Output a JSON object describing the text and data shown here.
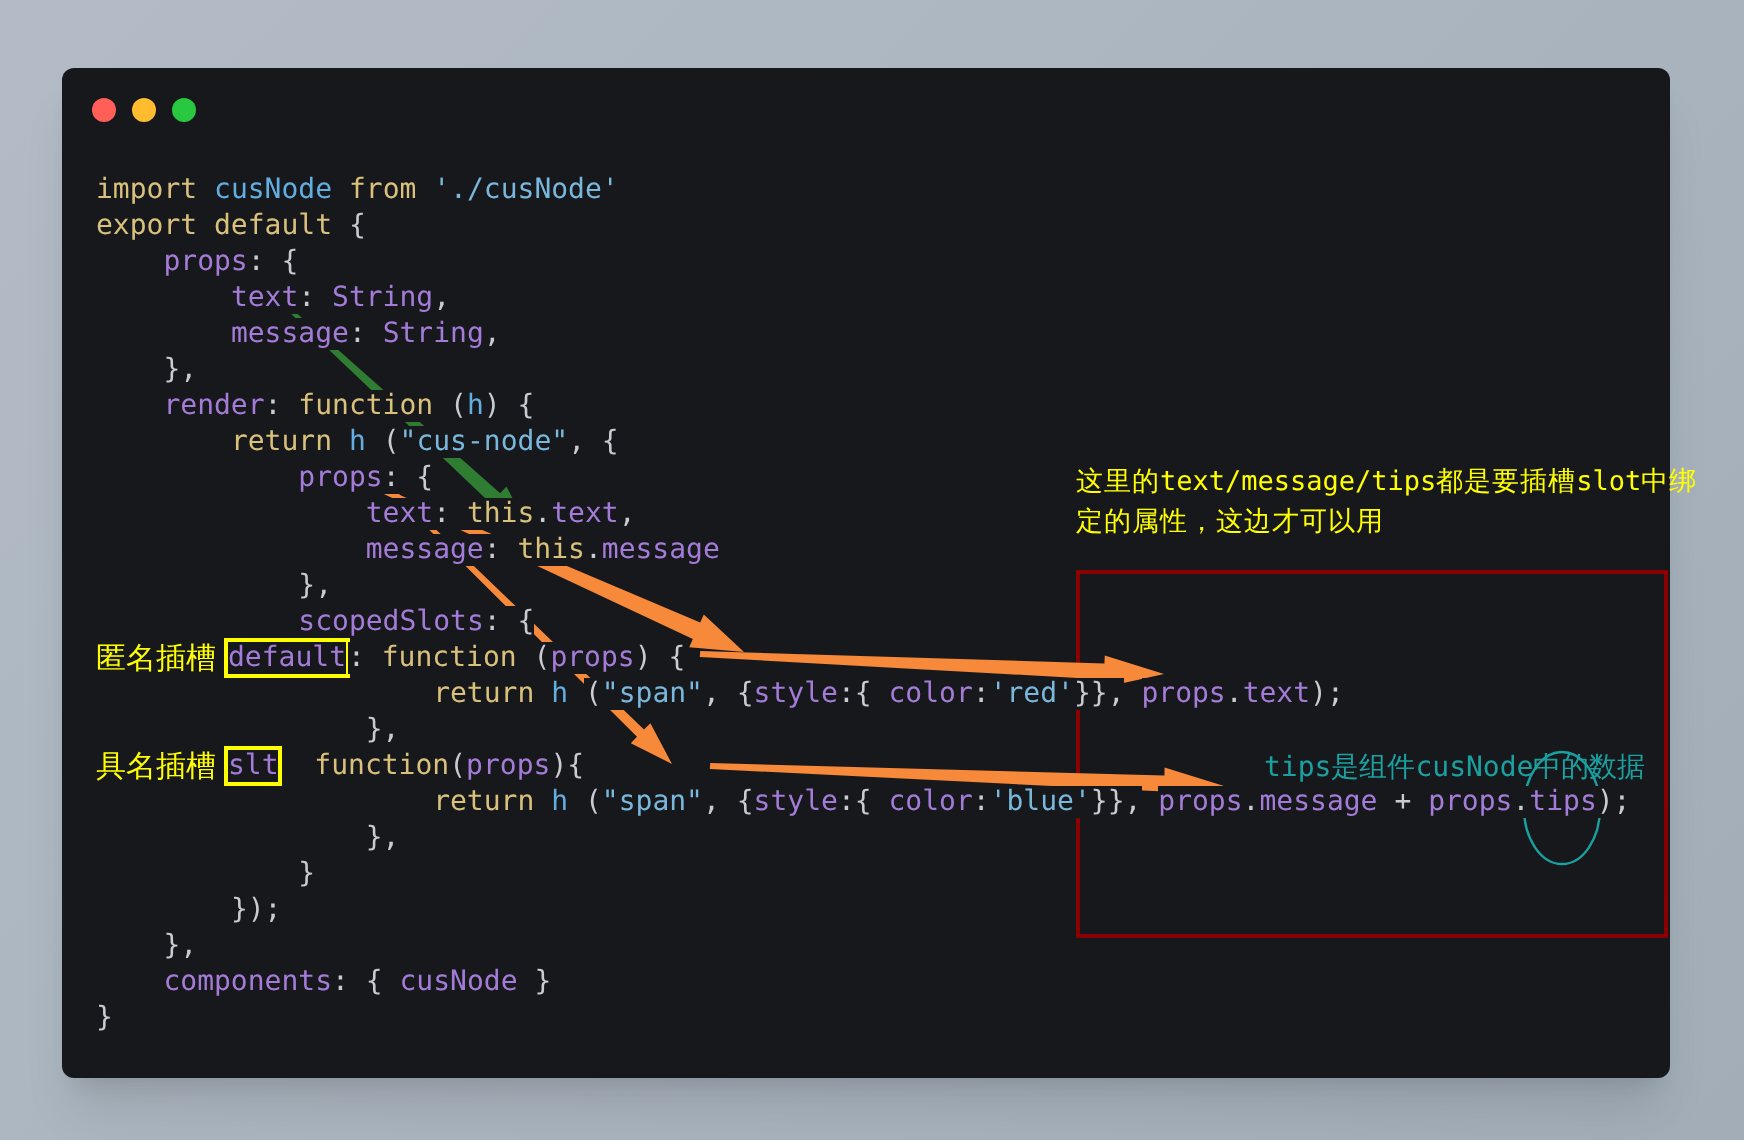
{
  "window": {
    "code_lines": [
      {
        "tokens": [
          {
            "kind": "kw",
            "text": "import"
          },
          {
            "kind": "ident",
            "text": " cusNode"
          },
          {
            "kind": "kw",
            "text": " from"
          },
          {
            "kind": "str",
            "text": " './cusNode'"
          }
        ]
      },
      {
        "tokens": [
          {
            "kind": "kw",
            "text": "export default"
          },
          {
            "kind": "punc",
            "text": " {"
          }
        ]
      },
      {
        "tokens": [
          {
            "kind": "prop",
            "text": "    props"
          },
          {
            "kind": "punc",
            "text": ": {"
          }
        ]
      },
      {
        "tokens": [
          {
            "kind": "prop",
            "text": "        text"
          },
          {
            "kind": "punc",
            "text": ": "
          },
          {
            "kind": "prop",
            "text": "String"
          },
          {
            "kind": "punc",
            "text": ","
          }
        ]
      },
      {
        "tokens": [
          {
            "kind": "prop",
            "text": "        message"
          },
          {
            "kind": "punc",
            "text": ": "
          },
          {
            "kind": "prop",
            "text": "String"
          },
          {
            "kind": "punc",
            "text": ","
          }
        ]
      },
      {
        "tokens": [
          {
            "kind": "punc",
            "text": "    },"
          }
        ]
      },
      {
        "tokens": [
          {
            "kind": "prop",
            "text": "    render"
          },
          {
            "kind": "punc",
            "text": ": "
          },
          {
            "kind": "kw",
            "text": "function"
          },
          {
            "kind": "punc",
            "text": " ("
          },
          {
            "kind": "ident",
            "text": "h"
          },
          {
            "kind": "punc",
            "text": ") {"
          }
        ]
      },
      {
        "tokens": [
          {
            "kind": "kw",
            "text": "        return"
          },
          {
            "kind": "ident",
            "text": " h"
          },
          {
            "kind": "punc",
            "text": " ("
          },
          {
            "kind": "str",
            "text": "\"cus-node\""
          },
          {
            "kind": "punc",
            "text": ", {"
          }
        ]
      },
      {
        "tokens": [
          {
            "kind": "prop",
            "text": "            props"
          },
          {
            "kind": "punc",
            "text": ": {"
          }
        ]
      },
      {
        "tokens": [
          {
            "kind": "prop",
            "text": "                text"
          },
          {
            "kind": "punc",
            "text": ": "
          },
          {
            "kind": "kw",
            "text": "this"
          },
          {
            "kind": "punc",
            "text": "."
          },
          {
            "kind": "prop",
            "text": "text"
          },
          {
            "kind": "punc",
            "text": ","
          }
        ]
      },
      {
        "tokens": [
          {
            "kind": "prop",
            "text": "                message"
          },
          {
            "kind": "punc",
            "text": ": "
          },
          {
            "kind": "kw",
            "text": "this"
          },
          {
            "kind": "punc",
            "text": "."
          },
          {
            "kind": "prop",
            "text": "message"
          }
        ]
      },
      {
        "tokens": [
          {
            "kind": "punc",
            "text": "            },"
          }
        ]
      },
      {
        "tokens": [
          {
            "kind": "prop",
            "text": "            scopedSlots"
          },
          {
            "kind": "punc",
            "text": ": {"
          }
        ]
      },
      {
        "tokens": [
          {
            "kind": "note",
            "text": "匿名插槽"
          },
          {
            "kind": "boxed",
            "text": "default"
          },
          {
            "kind": "punc",
            "text": ": "
          },
          {
            "kind": "kw",
            "text": "function"
          },
          {
            "kind": "punc",
            "text": " ("
          },
          {
            "kind": "prop",
            "text": "props"
          },
          {
            "kind": "punc",
            "text": ") {"
          }
        ]
      },
      {
        "tokens": [
          {
            "kind": "kw",
            "text": "                    return"
          },
          {
            "kind": "ident",
            "text": " h"
          },
          {
            "kind": "punc",
            "text": " ("
          },
          {
            "kind": "str",
            "text": "\"span\""
          },
          {
            "kind": "punc",
            "text": ", {"
          },
          {
            "kind": "prop",
            "text": "style"
          },
          {
            "kind": "punc",
            "text": ":{"
          },
          {
            "kind": "prop",
            "text": " color"
          },
          {
            "kind": "punc",
            "text": ":"
          },
          {
            "kind": "str",
            "text": "'red'"
          },
          {
            "kind": "punc",
            "text": "}},"
          },
          {
            "kind": "prop",
            "text": " props"
          },
          {
            "kind": "punc",
            "text": "."
          },
          {
            "kind": "prop",
            "text": "text"
          },
          {
            "kind": "punc",
            "text": ");"
          }
        ]
      },
      {
        "tokens": [
          {
            "kind": "punc",
            "text": "                },"
          }
        ]
      },
      {
        "tokens": [
          {
            "kind": "note",
            "text": "具名插槽"
          },
          {
            "kind": "boxed",
            "text": "slt"
          },
          {
            "kind": "kw",
            "text": "  function"
          },
          {
            "kind": "punc",
            "text": "("
          },
          {
            "kind": "prop",
            "text": "props"
          },
          {
            "kind": "punc",
            "text": "){"
          }
        ]
      },
      {
        "tokens": [
          {
            "kind": "kw",
            "text": "                    return"
          },
          {
            "kind": "ident",
            "text": " h"
          },
          {
            "kind": "punc",
            "text": " ("
          },
          {
            "kind": "str",
            "text": "\"span\""
          },
          {
            "kind": "punc",
            "text": ", {"
          },
          {
            "kind": "prop",
            "text": "style"
          },
          {
            "kind": "punc",
            "text": ":{"
          },
          {
            "kind": "prop",
            "text": " color"
          },
          {
            "kind": "punc",
            "text": ":"
          },
          {
            "kind": "str",
            "text": "'blue'"
          },
          {
            "kind": "punc",
            "text": "}},"
          },
          {
            "kind": "prop",
            "text": " props"
          },
          {
            "kind": "punc",
            "text": "."
          },
          {
            "kind": "prop",
            "text": "message"
          },
          {
            "kind": "punc",
            "text": " +"
          },
          {
            "kind": "prop",
            "text": " props"
          },
          {
            "kind": "punc",
            "text": "."
          },
          {
            "kind": "prop",
            "text": "tips"
          },
          {
            "kind": "punc",
            "text": ");"
          }
        ]
      },
      {
        "tokens": [
          {
            "kind": "punc",
            "text": "                },"
          }
        ]
      },
      {
        "tokens": [
          {
            "kind": "punc",
            "text": "            }"
          }
        ]
      },
      {
        "tokens": [
          {
            "kind": "punc",
            "text": "        });"
          }
        ]
      },
      {
        "tokens": [
          {
            "kind": "punc",
            "text": "    },"
          }
        ]
      },
      {
        "tokens": [
          {
            "kind": "prop",
            "text": "    components"
          },
          {
            "kind": "punc",
            "text": ": {"
          },
          {
            "kind": "prop",
            "text": " cusNode"
          },
          {
            "kind": "punc",
            "text": " }"
          }
        ]
      },
      {
        "tokens": [
          {
            "kind": "punc",
            "text": "}"
          }
        ]
      }
    ]
  },
  "annotations": {
    "slot_note": [
      "这里的text/message/tips都是要插槽slot中绑",
      "定的属性，这边才可以用"
    ],
    "tips_note": "tips是组件cusNode中的数据"
  }
}
